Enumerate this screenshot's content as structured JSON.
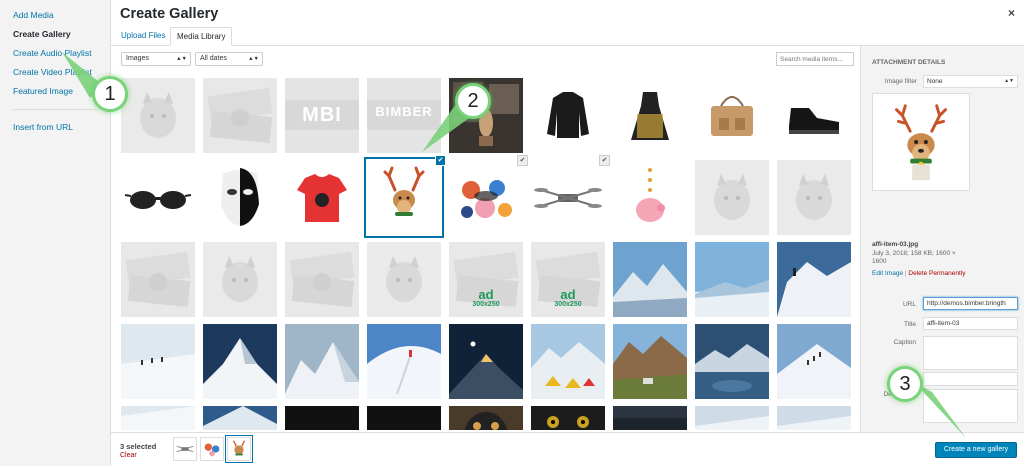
{
  "menu": {
    "items": [
      {
        "label": "Add Media",
        "active": false
      },
      {
        "label": "Create Gallery",
        "active": true
      },
      {
        "label": "Create Audio Playlist",
        "active": false
      },
      {
        "label": "Create Video Playlist",
        "active": false
      },
      {
        "label": "Featured Image",
        "active": false
      }
    ],
    "insert_url": "Insert from URL"
  },
  "modal": {
    "title": "Create Gallery",
    "close": "×"
  },
  "tabs": [
    {
      "label": "Upload Files",
      "active": false
    },
    {
      "label": "Media Library",
      "active": true
    }
  ],
  "toolbar": {
    "type_filter": "Images",
    "date_filter": "All dates",
    "search_placeholder": "Search media items..."
  },
  "grid": {
    "items": [
      {
        "kind": "placeholder-cat"
      },
      {
        "kind": "placeholder-dollar"
      },
      {
        "kind": "text-logo",
        "text": "MBI"
      },
      {
        "kind": "text-logo",
        "text": "BIMBER"
      },
      {
        "kind": "photo-mall"
      },
      {
        "kind": "jacket"
      },
      {
        "kind": "dress"
      },
      {
        "kind": "bag"
      },
      {
        "kind": "shoe"
      },
      {
        "kind": "sunglasses"
      },
      {
        "kind": "mask"
      },
      {
        "kind": "tshirt"
      },
      {
        "kind": "deer-dog",
        "selected": true
      },
      {
        "kind": "pattern"
      },
      {
        "kind": "drone",
        "checked": true
      },
      {
        "kind": "piggy"
      },
      {
        "kind": "placeholder-cat"
      },
      {
        "kind": "placeholder-cat"
      },
      {
        "kind": "placeholder-dollar"
      },
      {
        "kind": "placeholder-cat"
      },
      {
        "kind": "placeholder-dollar"
      },
      {
        "kind": "placeholder-cat"
      },
      {
        "kind": "ad",
        "line1": "ad",
        "line2": "300x250"
      },
      {
        "kind": "ad",
        "line1": "ad",
        "line2": "300x250"
      },
      {
        "kind": "mountain-blue"
      },
      {
        "kind": "mountain-sky"
      },
      {
        "kind": "climber"
      },
      {
        "kind": "snow-field"
      },
      {
        "kind": "mountain-dark"
      },
      {
        "kind": "snow-peak"
      },
      {
        "kind": "skier"
      },
      {
        "kind": "mountain-night"
      },
      {
        "kind": "camp"
      },
      {
        "kind": "mountain-valley"
      },
      {
        "kind": "lake"
      },
      {
        "kind": "snow-walk"
      },
      {
        "kind": "snow-bottom"
      },
      {
        "kind": "blue-bottom"
      },
      {
        "kind": "black"
      },
      {
        "kind": "black"
      },
      {
        "kind": "dog"
      },
      {
        "kind": "eyes"
      },
      {
        "kind": "dark-bottom"
      },
      {
        "kind": "pale-bottom"
      },
      {
        "kind": "pale-bottom"
      }
    ],
    "checked_top_index": 13,
    "checked_top2_index": 14
  },
  "details": {
    "heading": "ATTACHMENT DETAILS",
    "image_filter_label": "Image filter",
    "image_filter_value": "None",
    "filename": "affi-item-03.jpg",
    "meta1": "July 3, 2018; 158 KB; 1600 ×",
    "meta2": "1600",
    "edit_image": "Edit Image",
    "separator": "|",
    "delete": "Delete Permanently",
    "url_label": "URL",
    "url_value": "http://demos.bimber.bringth",
    "title_label": "Title",
    "title_value": "affi-item-03",
    "caption_label": "Caption",
    "desc_label": "Description"
  },
  "bottom": {
    "selected_count": "3 selected",
    "clear": "Clear",
    "create_button": "Create a new gallery"
  },
  "callouts": [
    "1",
    "2",
    "3"
  ],
  "colors": {
    "link": "#0073aa",
    "primary_button": "#0085ba",
    "delete": "#aa0000",
    "callout_green": "#7ad27a"
  }
}
